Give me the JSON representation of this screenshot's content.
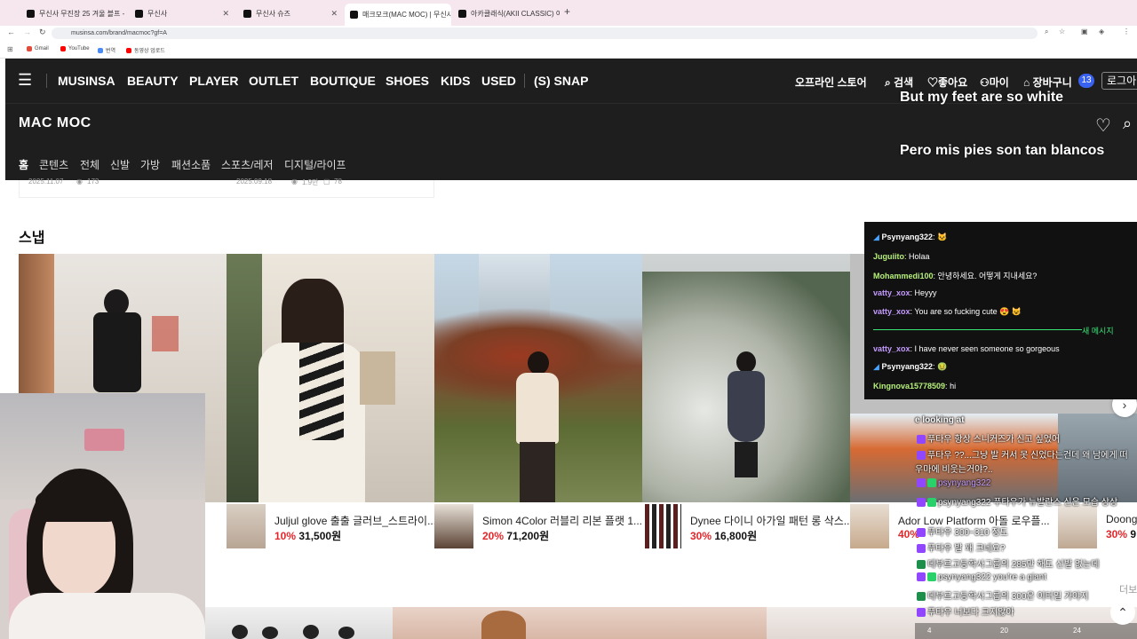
{
  "browser": {
    "tabs": [
      {
        "label": "무신사 무진장 25 겨울 블프 - 최",
        "active": false
      },
      {
        "label": "무신사",
        "active": false
      },
      {
        "label": "무신사 슈즈",
        "active": false
      },
      {
        "label": "매크모크(MAC MOC) | 무신사",
        "active": true
      },
      {
        "label": "아카클래식(AKII CLASSIC) 여기",
        "active": false
      }
    ],
    "new_tab": "+",
    "url": "musinsa.com/brand/macmoc?gf=A",
    "bookmarks": [
      "Gmail",
      "YouTube",
      "번역",
      "동영상 업로드"
    ]
  },
  "nav": {
    "items": [
      "MUSINSA",
      "BEAUTY",
      "PLAYER",
      "OUTLET",
      "BOUTIQUE",
      "SHOES",
      "KIDS",
      "USED",
      "(S) SNAP"
    ],
    "offline": "오프라인 스토어",
    "search": "검색",
    "like": "좋아요",
    "my": "마이",
    "cart": "장바구니",
    "cart_count": "13",
    "login": "로그아"
  },
  "brand": {
    "logo": "MAC MOC",
    "tabs": [
      "홈",
      "콘텐츠",
      "전체",
      "신발",
      "가방",
      "패션소품",
      "스포츠/레저",
      "디지털/라이프"
    ]
  },
  "captions": {
    "english": "But my feet are so white",
    "spanish": "Pero mis pies son tan blancos"
  },
  "content_meta": [
    {
      "date": "2025.11.07",
      "views": "173"
    },
    {
      "date": "2025.09.18",
      "views": "1.9만",
      "comments": "78"
    }
  ],
  "snap": {
    "title": "스냅",
    "products": [
      {
        "name": "Juljul glove 출출 글러브_스트라이...",
        "discount": "10%",
        "price": "31,500원"
      },
      {
        "name": "Simon 4Color 러블리 리본 플랫 1...",
        "discount": "20%",
        "price": "71,200원"
      },
      {
        "name": "Dynee 다이니 아가일 패턴 롱 삭스...",
        "discount": "30%",
        "price": "16,800원"
      },
      {
        "name": "Ador Low Platform 아돌 로우플...",
        "discount": "40%",
        "price": ""
      },
      {
        "name": "Doong",
        "discount": "30%",
        "price": "9"
      }
    ],
    "more": "더보기"
  },
  "chat_panel": {
    "messages": [
      {
        "user": "Psynyang322",
        "text": "🐱",
        "color": "#fff"
      },
      {
        "user": "Juguiito",
        "text": "Holaa",
        "color": "#b7f07a"
      },
      {
        "user": "Mohammedi100",
        "text": "안녕하세요. 어떻게 지내세요?",
        "color": "#b7f07a"
      },
      {
        "user": "vatty_xox",
        "text": "Heyyy",
        "color": "#c59bff"
      },
      {
        "user": "vatty_xox",
        "text": "You are so fucking cute 😍 😺",
        "color": "#c59bff"
      },
      {
        "user": "vatty_xox",
        "text": "I have never seen someone so gorgeous",
        "color": "#c59bff"
      },
      {
        "user": "Psynyang322",
        "text": "🤢",
        "color": "#fff"
      },
      {
        "user": "Kingnova15778509",
        "text": "hi",
        "color": "#b7f07a"
      }
    ],
    "new_messages": "새 메시지"
  },
  "overlay_chat": {
    "lines": [
      "e looking at",
      "푸타우 항상 스니커즈가 신고 싶었어",
      "푸타우 ??...그냥 발 커서 못 신었다는건데 왜 남에게 떠",
      "우마에 비웃는거야?..",
      "psynyang322",
      "psynyang322 푸타우가 뉴발란스 신은 모습 상상",
      "푸타우 300~310 정도",
      "푸타우 발 꽤 크네요?",
      "데부르고등학사그룹의 285만 해도 신발 없는데",
      "psynyang322 you're a giant",
      "데부르고등학사그룹의 300은 이터일 가야지",
      "푸타우 너보다 크지않아"
    ],
    "counts": [
      "4",
      "20",
      "24"
    ]
  },
  "colors": {
    "nav_bg": "#1e1e1e",
    "discount_red": "#e4262a",
    "cart_badge": "#3a62f0",
    "chat_bg": "#111111",
    "new_msg_green": "#3be477"
  }
}
